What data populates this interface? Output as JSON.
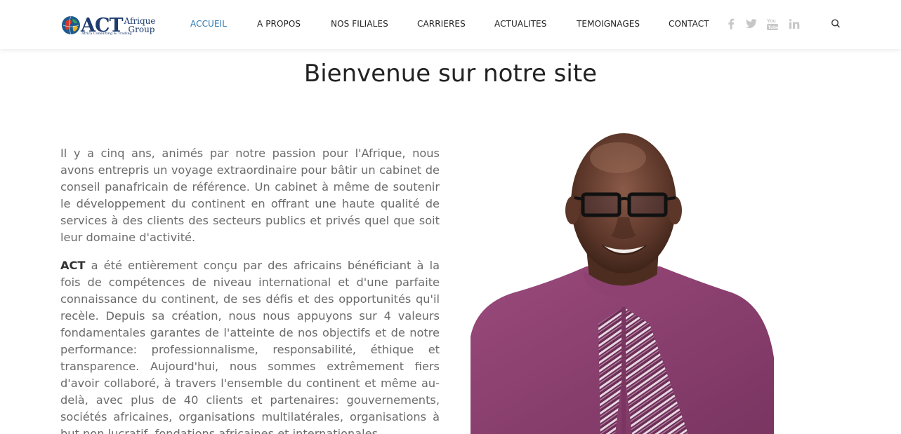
{
  "logo": {
    "act": "ACT",
    "afrique": "Afrique",
    "group": "Group",
    "tagline": "Africa Consulting & Trading"
  },
  "nav": {
    "items": [
      {
        "label": "ACCUEIL",
        "active": true
      },
      {
        "label": "A PROPOS"
      },
      {
        "label": "NOS FILIALES"
      },
      {
        "label": "CARRIERES"
      },
      {
        "label": "ACTUALITES"
      },
      {
        "label": "TEMOIGNAGES"
      },
      {
        "label": "CONTACT"
      }
    ],
    "active_color": "#2b79b1"
  },
  "social": {
    "icons": [
      "facebook-icon",
      "twitter-icon",
      "youtube-icon",
      "linkedin-icon"
    ],
    "color": "#c7c7c7"
  },
  "search": {
    "icon": "search-icon"
  },
  "main": {
    "title": "Bienvenue sur notre site",
    "paragraph1": "Il y a cinq ans, animés par notre passion pour l'Afrique, nous avons entrepris un voyage extraordinaire pour bâtir un cabinet de conseil panafricain de référence. Un cabinet à même de soutenir le développement du continent en offrant une haute qualité de services à des clients des secteurs publics et privés quel que soit leur domaine d'activité.",
    "paragraph2_strong": "ACT",
    "paragraph2": " a été entièrement conçu par des africains bénéficiant à la fois de compétences de niveau international et d'une parfaite connaissance du continent, de ses défis et des opportunités qu'il recèle. Depuis sa création, nous nous appuyons sur 4 valeurs fondamentales garantes de l'atteinte de nos objectifs et de notre performance: professionnalisme, responsabilité, éthique et transparence. Aujourd'hui, nous sommes extrêmement fiers d'avoir collaboré, à travers l'ensemble du continent et même au-delà, avec plus de 40 clients et partenaires: gouvernements, sociétés africaines, organisations multilatérales, organisations à but non lucratif, fondations africaines et internationales..."
  },
  "colors": {
    "brand": "#1d3b6e",
    "body_text": "#6b6b6b",
    "shirt": "#8a3f6d"
  }
}
